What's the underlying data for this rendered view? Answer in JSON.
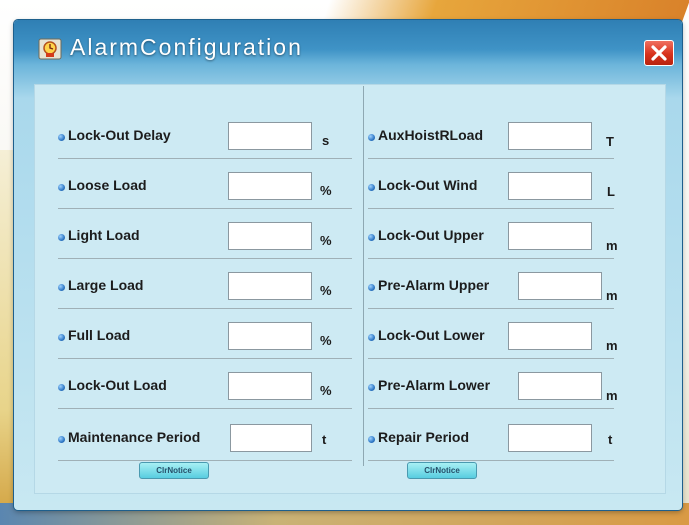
{
  "window": {
    "title": "AlarmConfiguration",
    "icon": "alarm-clock-app-icon",
    "close_icon": "close-x-icon"
  },
  "left_fields": [
    {
      "label": "Lock-Out Delay",
      "unit": "s",
      "value": ""
    },
    {
      "label": "Loose Load",
      "unit": "%",
      "value": ""
    },
    {
      "label": "Light Load",
      "unit": "%",
      "value": ""
    },
    {
      "label": "Large Load",
      "unit": "%",
      "value": ""
    },
    {
      "label": "Full Load",
      "unit": "%",
      "value": ""
    },
    {
      "label": "Lock-Out Load",
      "unit": "%",
      "value": ""
    },
    {
      "label": "Maintenance Period",
      "unit": "t",
      "value": ""
    }
  ],
  "right_fields": [
    {
      "label": "AuxHoistRLoad",
      "unit": "T",
      "value": ""
    },
    {
      "label": "Lock-Out Wind",
      "unit": "L",
      "value": ""
    },
    {
      "label": "Lock-Out Upper",
      "unit": "m",
      "value": ""
    },
    {
      "label": "Pre-Alarm Upper",
      "unit": "m",
      "value": ""
    },
    {
      "label": "Lock-Out Lower",
      "unit": "m",
      "value": ""
    },
    {
      "label": "Pre-Alarm Lower",
      "unit": "m",
      "value": ""
    },
    {
      "label": "Repair Period",
      "unit": "t",
      "value": ""
    }
  ],
  "buttons": {
    "left_clear_label": "ClrNotice",
    "right_clear_label": "ClrNotice"
  },
  "colors": {
    "titlebar": "#3f93c6",
    "panel": "#cdeaf3",
    "close_button": "#d8321c",
    "notice_button": "#58cde0"
  }
}
